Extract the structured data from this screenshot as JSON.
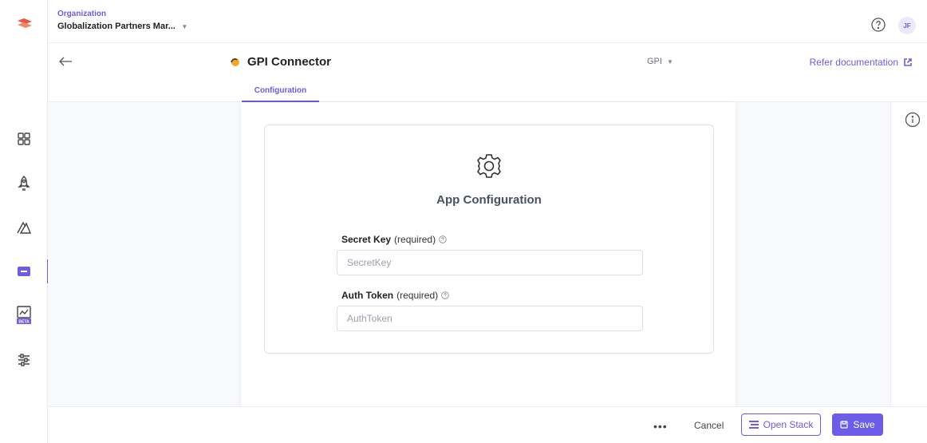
{
  "header": {
    "org_label": "Organization",
    "org_name": "Globalization Partners Mar...",
    "avatar_initials": "JF"
  },
  "app": {
    "title": "GPI Connector",
    "selector_value": "GPI",
    "refer_link": "Refer documentation",
    "tab_label": "Configuration"
  },
  "config": {
    "card_title": "App Configuration",
    "fields": [
      {
        "label": "Secret Key",
        "suffix": "(required)",
        "placeholder": "SecretKey",
        "value": ""
      },
      {
        "label": "Auth Token",
        "suffix": "(required)",
        "placeholder": "AuthToken",
        "value": ""
      }
    ]
  },
  "footer": {
    "more_label": "•••",
    "cancel_label": "Cancel",
    "open_stack_label": "Open Stack",
    "save_label": "Save"
  },
  "rail": {
    "items": [
      "dashboard-icon",
      "rocket-icon",
      "automate-icon",
      "marketplace-icon",
      "analytics-beta-icon",
      "settings-sliders-icon"
    ],
    "active_index": 3,
    "beta_badge": "BETA"
  },
  "colors": {
    "accent": "#6c5ce7",
    "canvas": "#f7f9fc",
    "logo": "#e8534a"
  }
}
